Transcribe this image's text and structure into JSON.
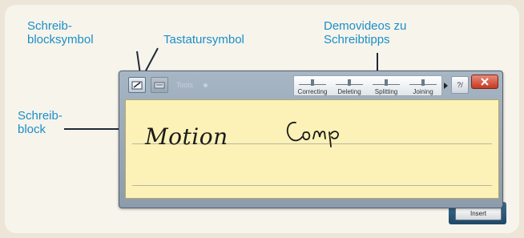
{
  "labels": {
    "writing_pad_icon_label": "Schreib-\nblocksymbol",
    "keyboard_icon_label": "Tastatursymbol",
    "demo_videos_label": "Demovideos zu\nSchreibtipps",
    "writing_pad_label": "Schreib-\nblock"
  },
  "input_panel": {
    "toolbar_misc": "Tools",
    "demo_videos": [
      {
        "label": "Correcting"
      },
      {
        "label": "Deleting"
      },
      {
        "label": "Splitting"
      },
      {
        "label": "Joining"
      }
    ],
    "help_label": "?/",
    "ink_word_1": "Motion",
    "ink_word_2": "Comp",
    "insert_label": "Insert"
  },
  "colors": {
    "annotation": "#1a8fc7",
    "pad": "#fcf1b6",
    "close": "#c43a22"
  }
}
